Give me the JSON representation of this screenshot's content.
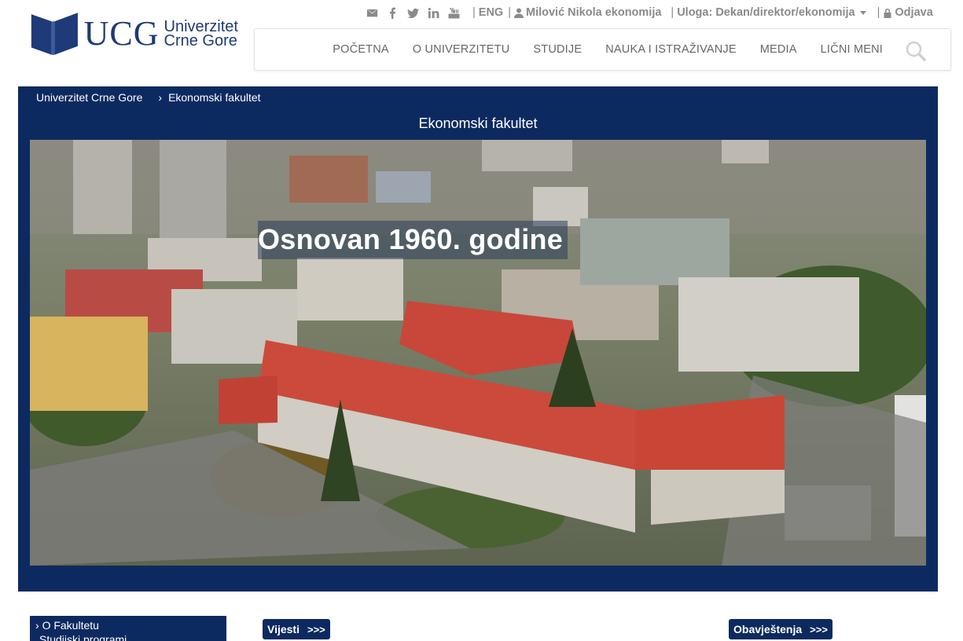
{
  "brand": {
    "short": "UCG",
    "line1": "Univerzitet",
    "line2": "Crne Gore",
    "color": "#1e3a78"
  },
  "topbar": {
    "icons": [
      "envelope-icon",
      "facebook-icon",
      "twitter-icon",
      "linkedin-icon",
      "youtube-icon"
    ],
    "lang": "ENG",
    "user": "Milović Nikola ekonomija",
    "role": "Uloga: Dekan/direktor/ekonomija",
    "logout": "Odjava"
  },
  "nav": {
    "items": [
      "POČETNA",
      "O UNIVERZITETU",
      "STUDIJE",
      "NAUKA I ISTRAŽIVANJE",
      "MEDIA",
      "LIČNI MENI"
    ]
  },
  "breadcrumb": {
    "root": "Univerzitet Crne Gore",
    "current": "Ekonomski fakultet"
  },
  "banner": {
    "title": "Ekonomski fakultet",
    "caption": "Osnovan 1960. godine",
    "background": "#0d2a60"
  },
  "sidebar": {
    "items": [
      "O Fakultetu",
      "Studijski programi"
    ]
  },
  "sections": {
    "news": "Vijesti",
    "news_arrow": ">>>",
    "notices": "Obavještenja",
    "notices_arrow": ">>>"
  }
}
